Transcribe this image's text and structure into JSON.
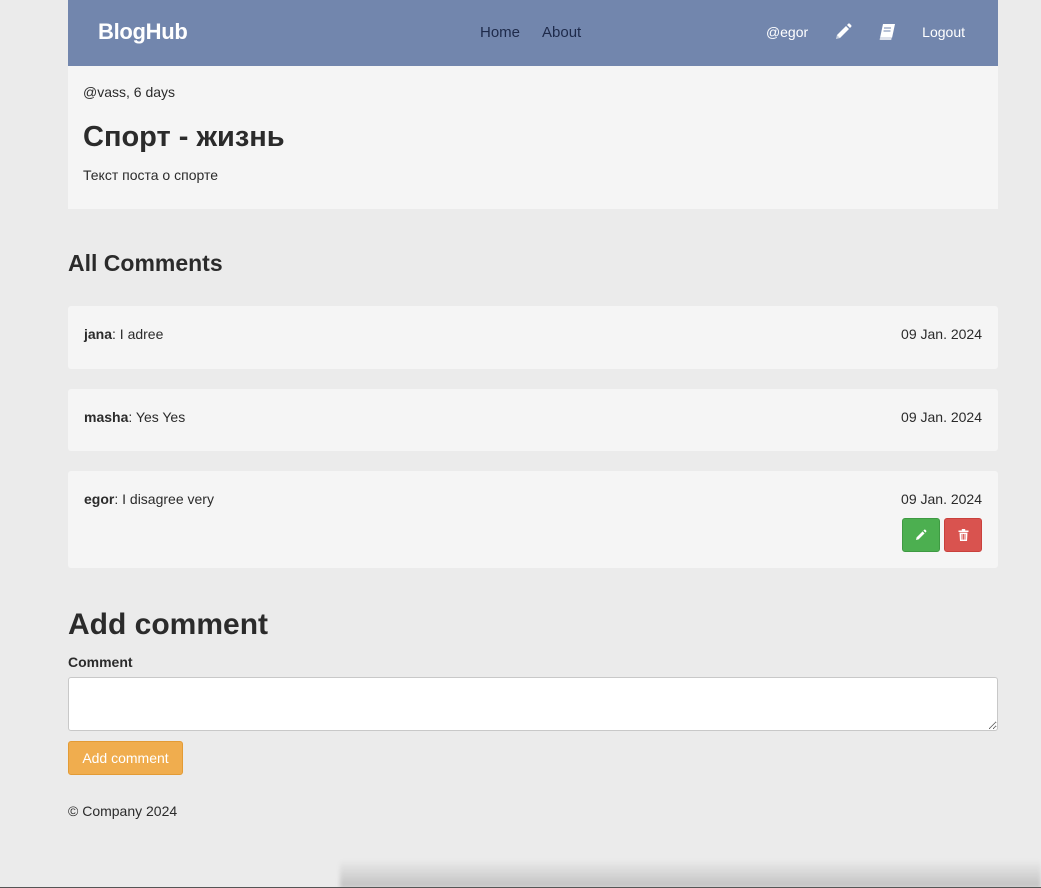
{
  "navbar": {
    "brand": "BlogHub",
    "links": [
      "Home",
      "About"
    ],
    "user": "@egor",
    "icons": [
      "pencil-icon",
      "book-icon"
    ],
    "logout": "Logout",
    "color": "#7286ad"
  },
  "post": {
    "meta": "@vass, 6 days",
    "title": "Спорт - жизнь",
    "body": "Текст поста о спорте"
  },
  "comments_section": {
    "title": "All Comments",
    "items": [
      {
        "author": "jana",
        "text": ": I adree",
        "date": "09 Jan. 2024"
      },
      {
        "author": "masha",
        "text": ": Yes Yes",
        "date": "09 Jan. 2024"
      },
      {
        "author": "egor",
        "text": ": I disagree very",
        "date": "09 Jan. 2024"
      }
    ],
    "edit_color": "#4caf50",
    "delete_color": "#d9534f"
  },
  "add_comment": {
    "title": "Add comment",
    "label": "Comment",
    "placeholder": "",
    "button": "Add comment",
    "button_color": "#f0ad4e"
  },
  "footer": {
    "text": "© Company 2024"
  }
}
